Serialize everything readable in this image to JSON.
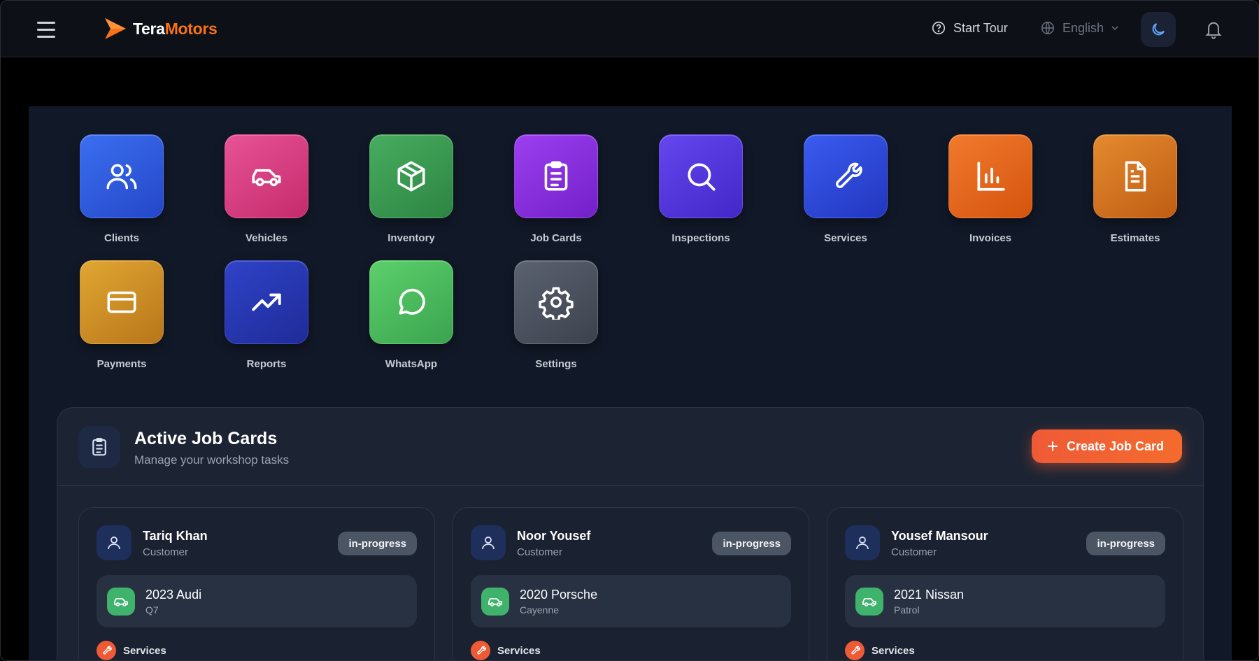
{
  "header": {
    "brand_part1": "Tera",
    "brand_part2": "Motors",
    "tour_label": "Start Tour",
    "language": "English",
    "accent": "#f97316"
  },
  "apps": [
    {
      "label": "Clients",
      "icon": "users-icon",
      "color": "#2f5fe6"
    },
    {
      "label": "Vehicles",
      "icon": "car-icon",
      "color": "#db3f82"
    },
    {
      "label": "Inventory",
      "icon": "box-icon",
      "color": "#3a9a50"
    },
    {
      "label": "Job Cards",
      "icon": "clipboard-icon",
      "color": "#8b2fe0"
    },
    {
      "label": "Inspections",
      "icon": "search-icon",
      "color": "#5637e0"
    },
    {
      "label": "Services",
      "icon": "wrench-icon",
      "color": "#2d4bd8"
    },
    {
      "label": "Invoices",
      "icon": "bar-chart-icon",
      "color": "#e8651e"
    },
    {
      "label": "Estimates",
      "icon": "document-icon",
      "color": "#d9741f"
    },
    {
      "label": "Payments",
      "icon": "credit-card-icon",
      "color": "#d08b22"
    },
    {
      "label": "Reports",
      "icon": "trending-up-icon",
      "color": "#2a3ab0"
    },
    {
      "label": "WhatsApp",
      "icon": "chat-icon",
      "color": "#46bb5a"
    },
    {
      "label": "Settings",
      "icon": "gear-icon",
      "color": "#4b5260"
    }
  ],
  "jobs": {
    "title": "Active Job Cards",
    "subtitle": "Manage your workshop tasks",
    "create_label": "Create Job Card",
    "cards": [
      {
        "name": "Tariq Khan",
        "role": "Customer",
        "status": "in-progress",
        "vehicle_make": "2023 Audi",
        "vehicle_model": "Q7",
        "section": "Services"
      },
      {
        "name": "Noor Yousef",
        "role": "Customer",
        "status": "in-progress",
        "vehicle_make": "2020 Porsche",
        "vehicle_model": "Cayenne",
        "section": "Services"
      },
      {
        "name": "Yousef Mansour",
        "role": "Customer",
        "status": "in-progress",
        "vehicle_make": "2021 Nissan",
        "vehicle_model": "Patrol",
        "section": "Services"
      }
    ]
  }
}
